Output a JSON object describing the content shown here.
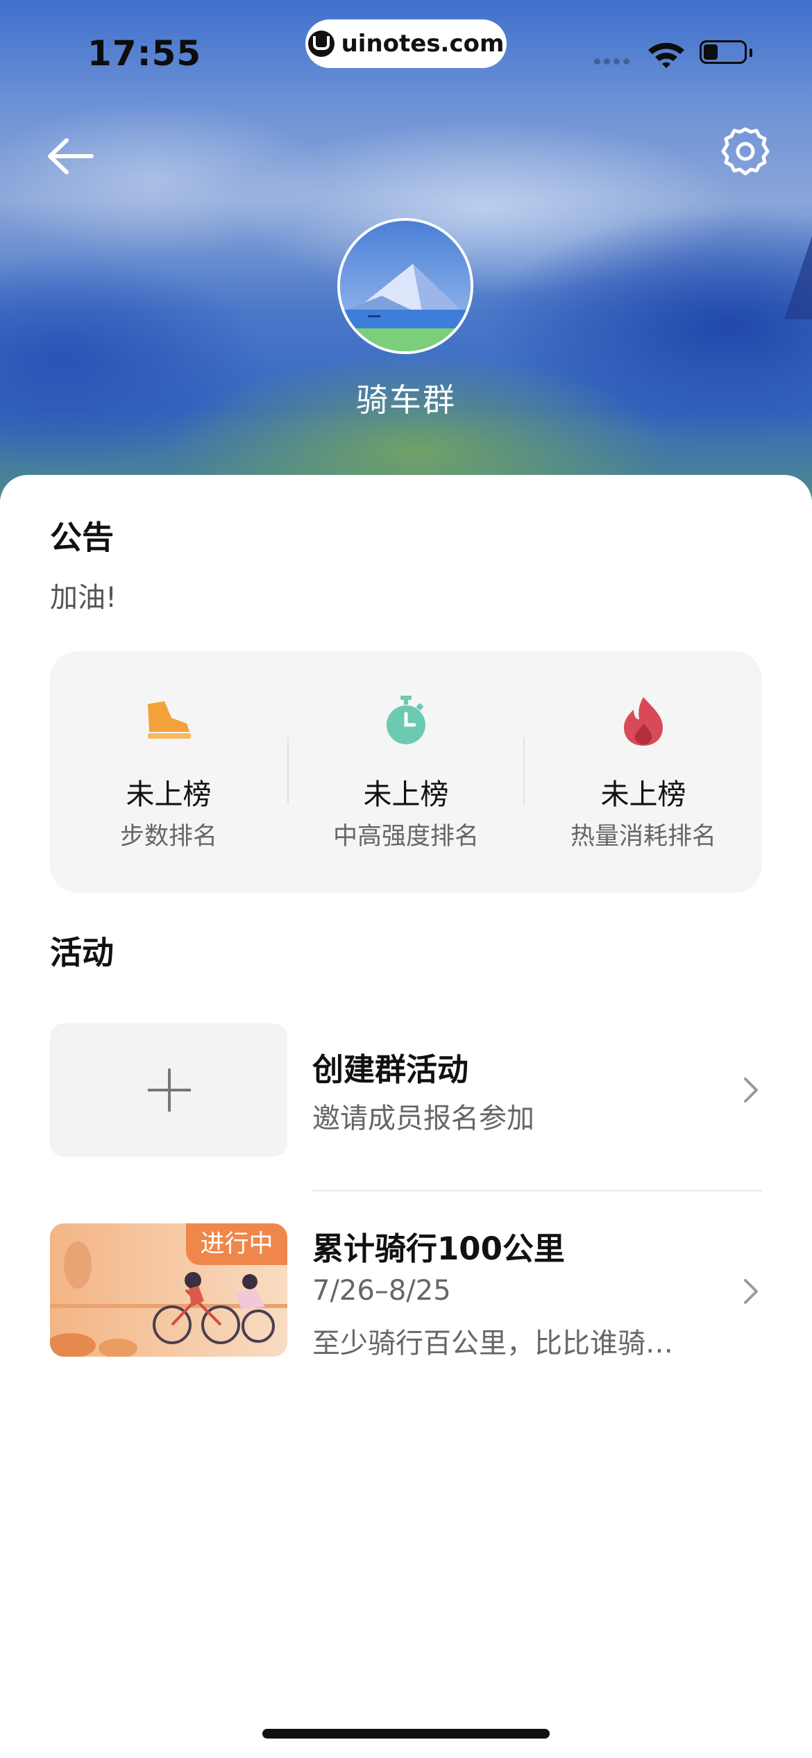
{
  "status_bar": {
    "time": "17:55",
    "url": "uinotes.com",
    "battery_level": 0.35,
    "icons": [
      "signal-icon",
      "wifi-icon",
      "battery-icon"
    ]
  },
  "header": {
    "back_icon": "arrow-left-icon",
    "settings_icon": "gear-icon",
    "group_name": "骑车群"
  },
  "notice": {
    "title": "公告",
    "text": "加油!"
  },
  "rankings": [
    {
      "status": "未上榜",
      "label": "步数排名",
      "icon": "shoe-icon",
      "color": "#f2a13b"
    },
    {
      "status": "未上榜",
      "label": "中高强度排名",
      "icon": "stopwatch-icon",
      "color": "#6ccab2"
    },
    {
      "status": "未上榜",
      "label": "热量消耗排名",
      "icon": "flame-icon",
      "color": "#d84a5a"
    }
  ],
  "activities": {
    "title": "活动",
    "create": {
      "title": "创建群活动",
      "subtitle": "邀请成员报名参加",
      "icon": "plus-icon"
    },
    "items": [
      {
        "title": "累计骑行100公里",
        "date": "7/26–8/25",
        "description": "至少骑行百公里，比比谁骑…",
        "badge": "进行中"
      }
    ]
  },
  "colors": {
    "badge": "#f0874a",
    "panel": "#f5f5f5"
  }
}
